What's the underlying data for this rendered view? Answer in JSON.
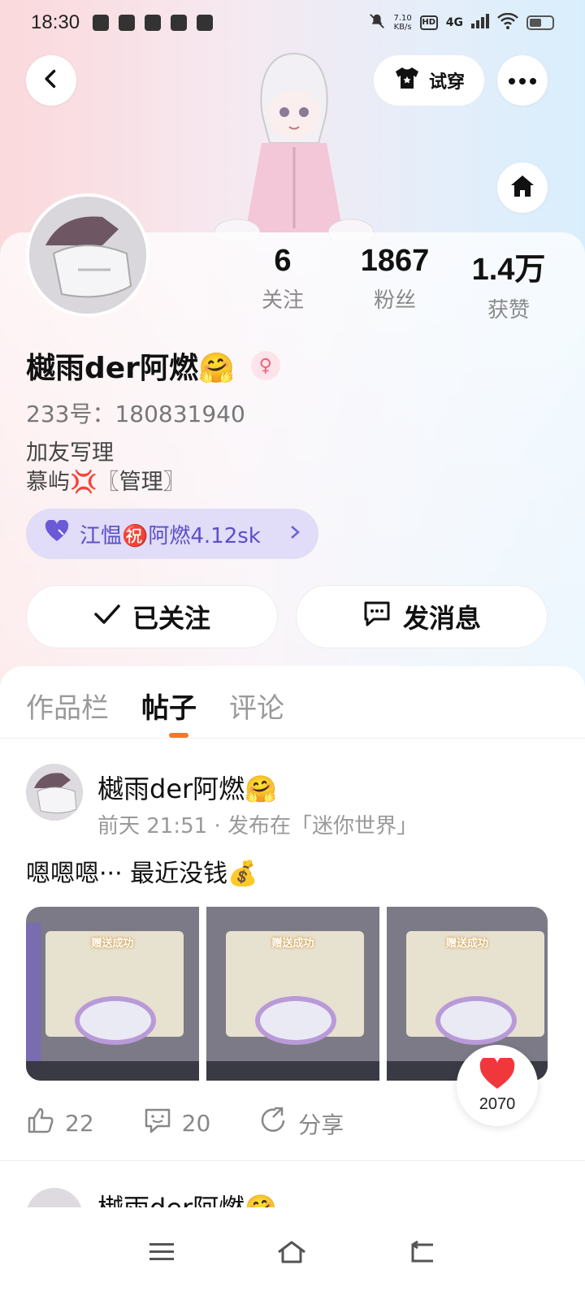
{
  "status_bar": {
    "time": "18:30",
    "net_speed": "7.10\nKB/s",
    "hd": "HD",
    "network": "4G"
  },
  "header": {
    "try_on_label": "试穿"
  },
  "stats": [
    {
      "num": "6",
      "label": "关注"
    },
    {
      "num": "1867",
      "label": "粉丝"
    },
    {
      "num": "1.4万",
      "label": "获赞"
    }
  ],
  "profile": {
    "username": "樾雨der阿燃🤗",
    "gender_symbol": "♀",
    "uid": "233号：180831940",
    "bio_line1": "加友写理",
    "bio_line2": "慕屿💢〖管理〗",
    "tag_text": "江愠㊗️阿燃4.12sk",
    "follow_label": "已关注",
    "message_label": "发消息"
  },
  "tabs": [
    {
      "label": "作品栏",
      "active": false
    },
    {
      "label": "帖子",
      "active": true
    },
    {
      "label": "评论",
      "active": false
    }
  ],
  "post": {
    "author": "樾雨der阿燃🤗",
    "meta": "前天 21:51 · 发布在「迷你世界」",
    "text": "嗯嗯嗯··· 最近没钱💰",
    "image_titles": [
      "赠送成功",
      "赠送成功",
      "赠送成功"
    ],
    "likes": "22",
    "comments": "20",
    "share": "分享"
  },
  "like_float": {
    "count": "2070"
  },
  "post2": {
    "author": "樾雨der阿燃🤗"
  },
  "colors": {
    "accent": "#f07a2c",
    "tag_bg": "#e1dcf7",
    "tag_text": "#5b4fc9"
  }
}
